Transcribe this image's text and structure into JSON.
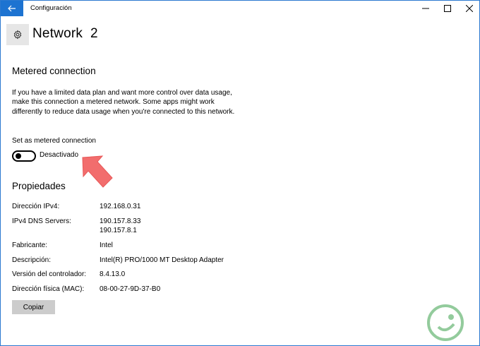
{
  "window": {
    "title": "Configuración",
    "minimize_glyph": "—",
    "maximize_glyph": "☐",
    "close_glyph": "✕"
  },
  "page": {
    "title": "Network  2",
    "icon": "gear-icon"
  },
  "metered": {
    "heading": "Metered connection",
    "description": "If you have a limited data plan and want more control over data usage, make this connection a metered network. Some apps might work differently to reduce data usage when you're connected to this network.",
    "toggle_label": "Set as metered connection",
    "toggle_state": "Desactivado",
    "toggle_on": false
  },
  "properties": {
    "heading": "Propiedades",
    "rows": [
      {
        "label": "Dirección IPv4:",
        "value": "192.168.0.31"
      },
      {
        "label": "IPv4 DNS Servers:",
        "value": "190.157.8.33",
        "value2": "190.157.8.1"
      },
      {
        "label": "Fabricante:",
        "value": "Intel"
      },
      {
        "label": "Descripción:",
        "value": "Intel(R) PRO/1000 MT Desktop Adapter"
      },
      {
        "label": "Versión del controlador:",
        "value": "8.4.13.0"
      },
      {
        "label": "Dirección física (MAC):",
        "value": "08-00-27-9D-37-B0"
      }
    ],
    "copy_button": "Copiar"
  },
  "colors": {
    "accent": "#1d73d1",
    "arrow": "#f26d6d",
    "button_bg": "#cccccc",
    "icon_tile": "#e6e6e6",
    "watermark": "#3aa04a"
  }
}
